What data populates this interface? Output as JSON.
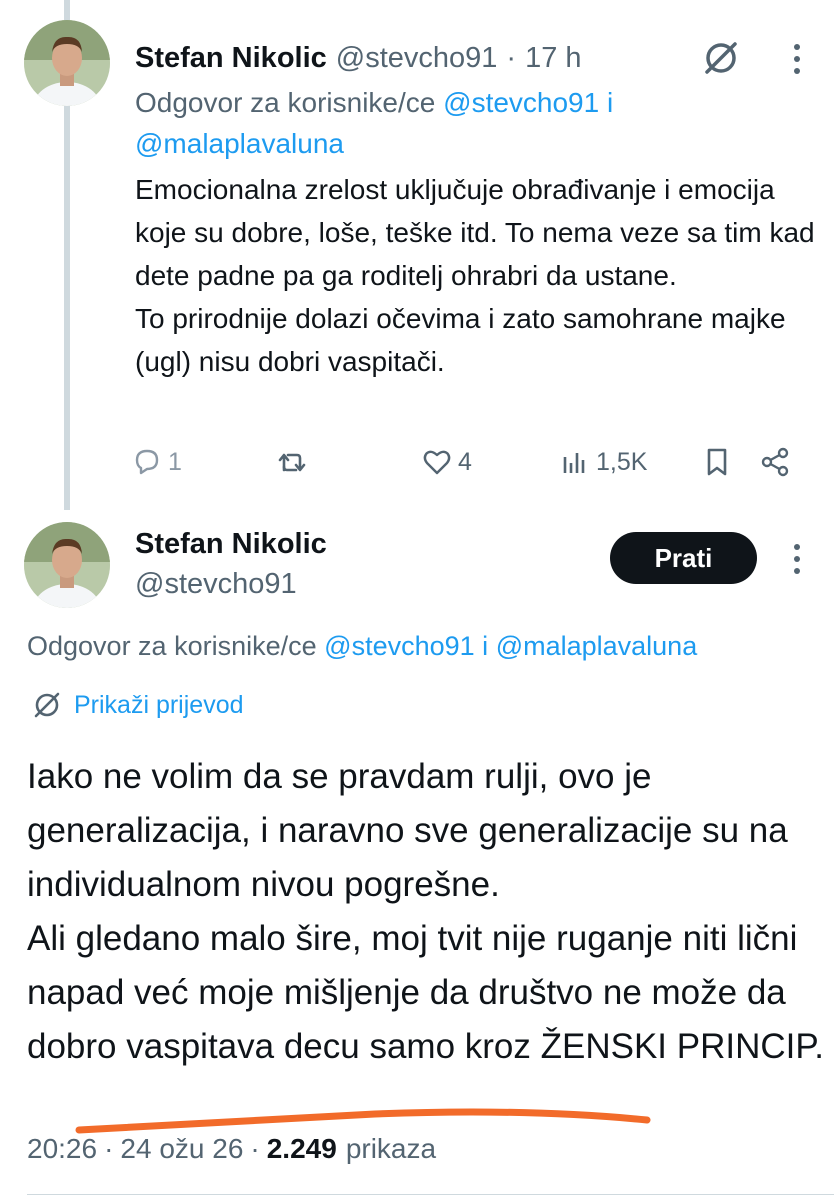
{
  "reply_tweet": {
    "author_name": "Stefan Nikolic",
    "handle": "@stevcho91",
    "separator": "·",
    "time": "17 h",
    "context_prefix": "Odgovor za korisnike/ce",
    "mention_1": "@stevcho91",
    "conjunction": "i",
    "mention_2": "@malaplavaluna",
    "body": [
      "Emocionalna zrelost uključuje obrađivanje i emocija koje su dobre, loše, teške itd. To nema veze sa tim kad dete padne pa ga roditelj ohrabri da ustane.",
      "To prirodnije dolazi očevima i zato samohrane majke (ugl) nisu dobri vaspitači."
    ],
    "actions": {
      "replies": "1",
      "likes": "4",
      "views": "1,5K"
    }
  },
  "main_tweet": {
    "author_name": "Stefan Nikolic",
    "handle": "@stevcho91",
    "follow_label": "Prati",
    "context_prefix": "Odgovor za korisnike/ce",
    "mention_1": "@stevcho91",
    "conjunction": "i",
    "mention_2": "@malaplavaluna",
    "translate_label": "Prikaži prijevod",
    "body": [
      "Iako ne volim da se pravdam rulji, ovo je generalizacija, i naravno sve generalizacije su na individualnom nivou pogrešne.",
      "Ali gledano malo šire, moj tvit nije ruganje niti lični napad već moje mišljenje da društvo ne može da dobro vaspitava decu samo kroz ŽENSKI PRINCIP."
    ],
    "time": "20:26",
    "date": "24 ožu 26",
    "separator": "·",
    "views_count": "2.249",
    "views_label": "prikaza"
  },
  "colors": {
    "text": "#0f1419",
    "secondary": "#536471",
    "accent": "#1d9bf0",
    "highlight": "#f26b2a"
  }
}
